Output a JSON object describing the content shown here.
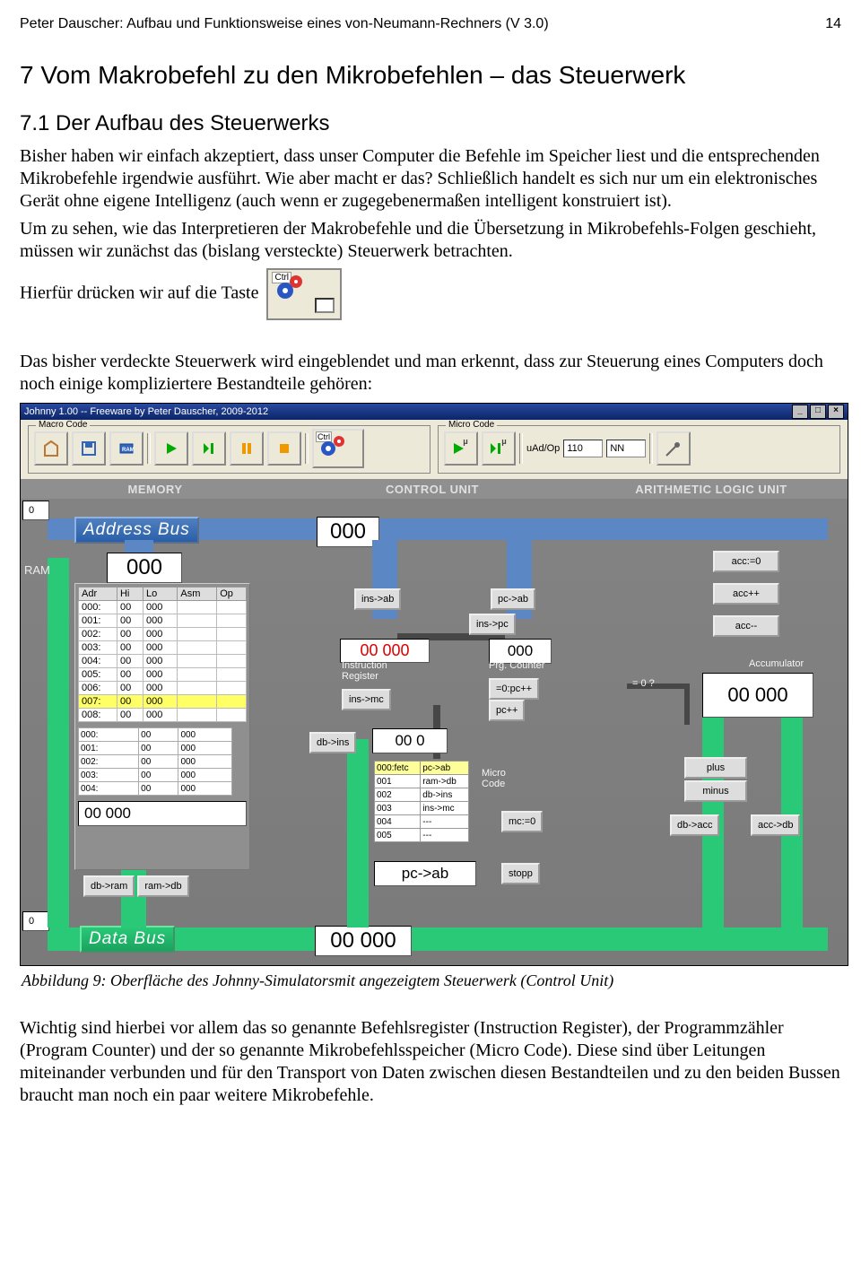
{
  "header": {
    "title": "Peter Dauscher: Aufbau und Funktionsweise eines von-Neumann-Rechners (V 3.0)",
    "page": "14"
  },
  "h1": "7  Vom Makrobefehl zu den Mikrobefehlen – das Steuerwerk",
  "h2": "7.1  Der Aufbau des Steuerwerks",
  "p1": "Bisher haben wir einfach akzeptiert, dass unser Computer die Befehle im Speicher liest und die entsprechenden Mikrobefehle irgendwie ausführt. Wie aber macht er das? Schließlich handelt es sich nur um ein elektronisches Gerät ohne eigene Intelligenz (auch wenn er zugegebenermaßen intelligent konstruiert ist).",
  "p2": "Um zu sehen, wie das Interpretieren der Makrobefehle und die Übersetzung in Mikrobefehls-Folgen geschieht, müssen wir zunächst das (bislang versteckte) Steuerwerk betrachten.",
  "p3": "Hierfür drücken wir auf die Taste",
  "p4": "Das bisher verdeckte Steuerwerk wird eingeblendet und man erkennt, dass zur Steuerung eines Computers doch noch einige kompliziertere Bestandteile gehören:",
  "caption": "Abbildung 9: Oberfläche des Johnny-Simulatorsmit angezeigtem Steuerwerk (Control Unit)",
  "p5": "Wichtig sind hierbei vor allem das so genannte Befehlsregister (Instruction Register), der Programmzähler (Program Counter) und der so genannte Mikrobefehlsspeicher (Micro Code). Diese sind über Leitungen miteinander verbunden und für den Transport von Daten zwischen diesen Bestandteilen und zu den beiden Bussen braucht man noch ein paar weitere Mikrobefehle.",
  "sim": {
    "title": "Johnny 1.00 -- Freeware by Peter Dauscher, 2009-2012",
    "toolbar": {
      "macro_legend": "Macro Code",
      "micro_legend": "Micro Code",
      "ctrl_key": "Ctrl",
      "uad_label": "uAd/Op",
      "uad_value": "110",
      "nn": "NN"
    },
    "cols": {
      "mem": "MEMORY",
      "cu": "CONTROL UNIT",
      "alu": "ARITHMETIC LOGIC UNIT"
    },
    "address_bus": {
      "label": "Address Bus",
      "value": "000",
      "left_input": "0"
    },
    "data_bus": {
      "label": "Data Bus",
      "value": "00 000",
      "left_input": "0"
    },
    "ram": {
      "label": "RAM",
      "value": "000",
      "hder": [
        "Adr",
        "Hi",
        "Lo",
        "Asm",
        "Op"
      ],
      "rows": [
        [
          "000:",
          "00",
          "000",
          "",
          ""
        ],
        [
          "001:",
          "00",
          "000",
          "",
          ""
        ],
        [
          "002:",
          "00",
          "000",
          "",
          ""
        ],
        [
          "003:",
          "00",
          "000",
          "",
          ""
        ],
        [
          "004:",
          "00",
          "000",
          "",
          ""
        ],
        [
          "005:",
          "00",
          "000",
          "",
          ""
        ],
        [
          "006:",
          "00",
          "000",
          "",
          ""
        ],
        [
          "007:",
          "00",
          "000",
          "",
          ""
        ],
        [
          "008:",
          "00",
          "000",
          "",
          ""
        ]
      ],
      "hl_idx": 7,
      "cache": [
        [
          "000:",
          "00",
          "000"
        ],
        [
          "001:",
          "00",
          "000"
        ],
        [
          "002:",
          "00",
          "000"
        ],
        [
          "003:",
          "00",
          "000"
        ],
        [
          "004:",
          "00",
          "000"
        ]
      ],
      "bottom": "00 000",
      "btn1": "db->ram",
      "btn2": "ram->db"
    },
    "ir": {
      "value": "00 000",
      "label": "Instruction Register",
      "btns": [
        "ins->ab",
        "ins->mc"
      ],
      "db_value": "00   0",
      "db_btn": "db->ins"
    },
    "pc": {
      "value": "000",
      "label": "Prg. Counter",
      "btns_top": [
        "pc->ab",
        "ins->pc"
      ],
      "btns": [
        "=0:pc++",
        "pc++"
      ]
    },
    "mc": {
      "label": "Micro Code",
      "rows": [
        [
          "000:fetc",
          "pc->ab"
        ],
        [
          "001",
          "ram->db"
        ],
        [
          "002",
          "db->ins"
        ],
        [
          "003",
          "ins->mc"
        ],
        [
          "004",
          "---"
        ],
        [
          "005",
          "---"
        ]
      ],
      "current": "pc->ab",
      "btns": [
        "mc:=0",
        "stopp"
      ]
    },
    "alu": {
      "label": "Accumulator",
      "value": "00 000",
      "is0": "= 0 ?",
      "b1": "acc:=0",
      "b2": "acc++",
      "b3": "acc--",
      "b4": "plus",
      "b5": "minus",
      "b6": "db->acc",
      "b7": "acc->db"
    }
  }
}
